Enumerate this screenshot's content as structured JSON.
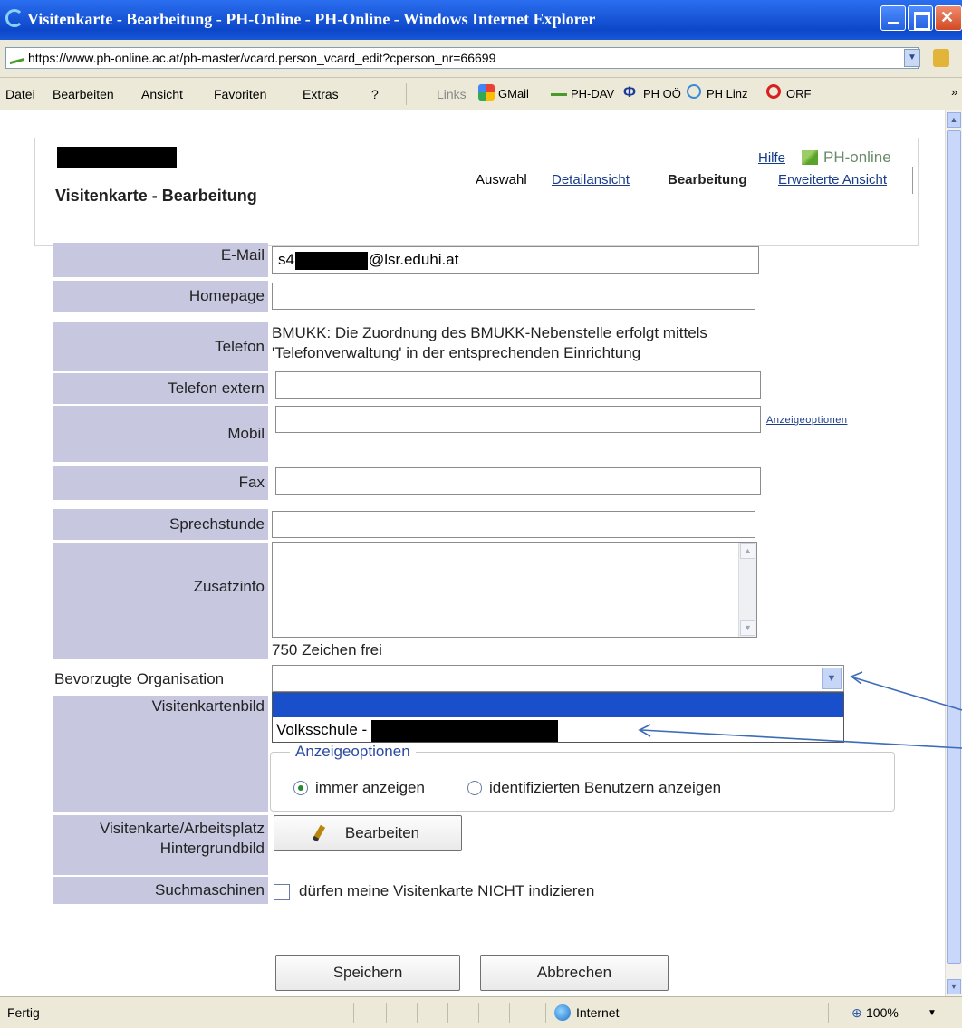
{
  "window": {
    "title": "Visitenkarte - Bearbeitung - PH-Online - PH-Online - Windows Internet Explorer"
  },
  "address": {
    "url": "https://www.ph-online.ac.at/ph-master/vcard.person_vcard_edit?cperson_nr=66699"
  },
  "menubar": {
    "items": [
      "Datei",
      "Bearbeiten",
      "Ansicht",
      "Favoriten",
      "Extras",
      "?"
    ],
    "links_label": "Links",
    "links": [
      "GMail",
      "PH-DAV",
      "PH OÖ",
      "PH Linz",
      "ORF"
    ],
    "more": "»"
  },
  "header": {
    "help": "Hilfe",
    "brand": "PH-online",
    "page_title": "Visitenkarte - Bearbeitung",
    "tabs": [
      {
        "label": "Auswahl",
        "state": "plain"
      },
      {
        "label": "Detailansicht",
        "state": "link"
      },
      {
        "label": "Bearbeitung",
        "state": "active"
      },
      {
        "label": "Erweiterte Ansicht",
        "state": "link"
      }
    ]
  },
  "form": {
    "email": {
      "label": "E-Mail",
      "prefix": "s4",
      "suffix": "@lsr.eduhi.at"
    },
    "homepage": {
      "label": "Homepage",
      "value": ""
    },
    "telefon": {
      "label": "Telefon",
      "info_line1": "BMUKK: Die Zuordnung des BMUKK-Nebenstelle erfolgt mittels",
      "info_line2": "'Telefonverwaltung' in der entsprechenden Einrichtung"
    },
    "telefon_extern": {
      "label": "Telefon extern",
      "value": ""
    },
    "mobil": {
      "label": "Mobil",
      "value": "",
      "options_link": "Anzeigeoptionen"
    },
    "fax": {
      "label": "Fax",
      "value": ""
    },
    "sprechstunde": {
      "label": "Sprechstunde",
      "value": ""
    },
    "zusatzinfo": {
      "label": "Zusatzinfo",
      "value": "",
      "chars_free": "750 Zeichen frei"
    },
    "organisation": {
      "label": "Bevorzugte Organisation",
      "value": "",
      "options": [
        "",
        "Volksschule - "
      ]
    },
    "visitenkartenbild": {
      "label": "Visitenkartenbild",
      "legend": "Anzeigeoptionen",
      "radio_always": "immer anzeigen",
      "radio_identified": "identifizierten Benutzern anzeigen",
      "selected": "immer anzeigen"
    },
    "hintergrund": {
      "label_line1": "Visitenkarte/Arbeitsplatz",
      "label_line2": "Hintergrundbild",
      "button": "Bearbeiten"
    },
    "suchmaschinen": {
      "label": "Suchmaschinen",
      "checkbox_label": "dürfen meine Visitenkarte NICHT indizieren",
      "checked": false
    },
    "save": "Speichern",
    "cancel": "Abbrechen"
  },
  "status": {
    "text": "Fertig",
    "zone": "Internet",
    "zoom": "100%"
  }
}
